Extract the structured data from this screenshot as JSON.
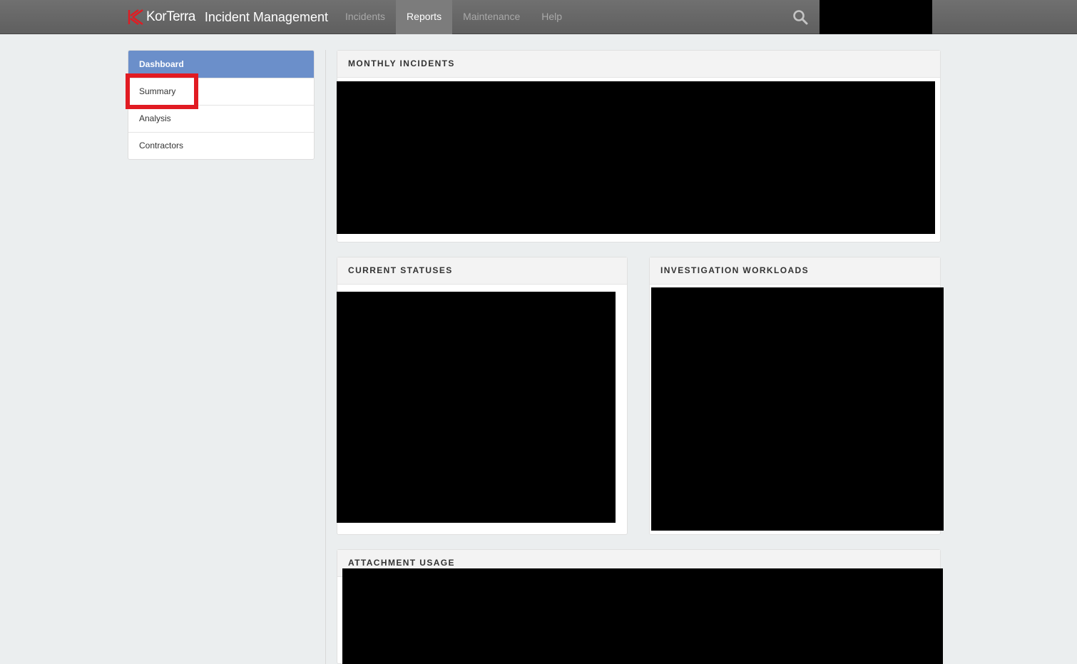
{
  "header": {
    "brand": "KorTerra",
    "product": "Incident Management",
    "tabs": [
      {
        "label": "Incidents",
        "active": false
      },
      {
        "label": "Reports",
        "active": true
      },
      {
        "label": "Maintenance",
        "active": false
      },
      {
        "label": "Help",
        "active": false
      }
    ],
    "search_icon": "search-icon",
    "colors": {
      "bar": "#666666",
      "logo": "#e11b22"
    }
  },
  "sidebar": {
    "header": "Dashboard",
    "items": [
      {
        "label": "Summary",
        "highlighted": true
      },
      {
        "label": "Analysis"
      },
      {
        "label": "Contractors"
      }
    ],
    "accent": "#6b8fca"
  },
  "panels": {
    "monthly": {
      "title": "MONTHLY INCIDENTS"
    },
    "statuses": {
      "title": "CURRENT STATUSES"
    },
    "workloads": {
      "title": "INVESTIGATION WORKLOADS"
    },
    "attachments": {
      "title": "ATTACHMENT USAGE"
    }
  }
}
